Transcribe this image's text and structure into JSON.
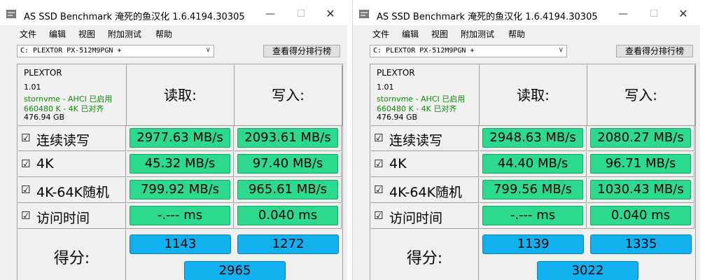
{
  "windows": [
    {
      "title": "AS SSD Benchmark 淹死的鱼汉化 1.6.4194.30305",
      "controls": {
        "minimize": "—",
        "maximize": "☐",
        "close": "✕"
      },
      "menu": [
        "文件",
        "编辑",
        "视图",
        "附加测试",
        "帮助"
      ],
      "drive_select": {
        "value": "C: PLEXTOR PX-512M9PGN +"
      },
      "ranking_button": "查看得分排行榜",
      "device": {
        "model": "PLEXTOR",
        "firmware": "1.01",
        "driver": "stornvme - AHCI 已启用",
        "alignment": "660480 K - 4K 已对齐",
        "capacity": "476.94 GB"
      },
      "headers": {
        "read": "读取:",
        "write": "写入:"
      },
      "rows": [
        {
          "check": "☑",
          "label": "连续读写",
          "read": "2977.63 MB/s",
          "write": "2093.61 MB/s"
        },
        {
          "check": "☑",
          "label": "4K",
          "read": "45.32 MB/s",
          "write": "97.40 MB/s"
        },
        {
          "check": "☑",
          "label": "4K-64K随机",
          "read": "799.92 MB/s",
          "write": "965.61 MB/s"
        },
        {
          "check": "☑",
          "label": "访问时间",
          "read": "-.--- ms",
          "write": "0.040 ms"
        }
      ],
      "score": {
        "label": "得分:",
        "read": "1143",
        "write": "1272",
        "total": "2965"
      }
    },
    {
      "title": "AS SSD Benchmark 淹死的鱼汉化 1.6.4194.30305",
      "controls": {
        "minimize": "—",
        "maximize": "☐",
        "close": "✕"
      },
      "menu": [
        "文件",
        "编辑",
        "视图",
        "附加测试",
        "帮助"
      ],
      "drive_select": {
        "value": "C: PLEXTOR PX-512M9PGN +"
      },
      "ranking_button": "查看得分排行榜",
      "device": {
        "model": "PLEXTOR",
        "firmware": "1.01",
        "driver": "stornvme - AHCI 已启用",
        "alignment": "660480 K - 4K 已对齐",
        "capacity": "476.94 GB"
      },
      "headers": {
        "read": "读取:",
        "write": "写入:"
      },
      "rows": [
        {
          "check": "☑",
          "label": "连续读写",
          "read": "2948.63 MB/s",
          "write": "2080.27 MB/s"
        },
        {
          "check": "☑",
          "label": "4K",
          "read": "44.40 MB/s",
          "write": "96.71 MB/s"
        },
        {
          "check": "☑",
          "label": "4K-64K随机",
          "read": "799.56 MB/s",
          "write": "1030.43 MB/s"
        },
        {
          "check": "☑",
          "label": "访问时间",
          "read": "-.--- ms",
          "write": "0.040 ms"
        }
      ],
      "score": {
        "label": "得分:",
        "read": "1139",
        "write": "1335",
        "total": "3022"
      }
    }
  ],
  "colors": {
    "result_green": "#2bd98f",
    "score_blue": "#11b0ef",
    "driver_text_green": "#0a8f0a"
  }
}
